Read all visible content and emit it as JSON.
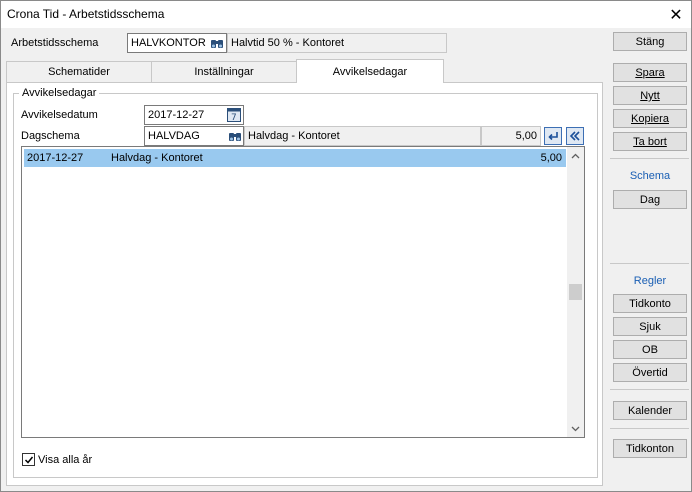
{
  "window": {
    "title": "Crona Tid - Arbetstidsschema",
    "close_glyph": "✕"
  },
  "header": {
    "schema_label": "Arbetstidsschema",
    "schema_code": "HALVKONTOR",
    "schema_desc": "Halvtid 50 % - Kontoret",
    "stang_label": "Stäng"
  },
  "tabs": [
    {
      "label": "Schematider",
      "active": false
    },
    {
      "label": "Inställningar",
      "active": false
    },
    {
      "label": "Avvikelsedagar",
      "active": true
    }
  ],
  "panel": {
    "group_title": "Avvikelsedagar",
    "date_label": "Avvikelsedatum",
    "date_value": "2017-12-27",
    "dagschema_label": "Dagschema",
    "dagschema_code": "HALVDAG",
    "dagschema_desc": "Halvdag - Kontoret",
    "dagschema_hours": "5,00",
    "rows": [
      {
        "date": "2017-12-27",
        "desc": "Halvdag - Kontoret",
        "hours": "5,00",
        "selected": true
      }
    ],
    "visa_alla_label": "Visa alla år",
    "visa_alla_checked": true
  },
  "sidebar": {
    "spara": "Spara",
    "nytt": "Nytt",
    "kopiera": "Kopiera",
    "ta_bort": "Ta bort",
    "schema_heading": "Schema",
    "dag": "Dag",
    "regler_heading": "Regler",
    "tidkonto": "Tidkonto",
    "sjuk": "Sjuk",
    "ob": "OB",
    "overtid": "Övertid",
    "kalender": "Kalender",
    "tidkonton": "Tidkonton"
  },
  "colors": {
    "selection": "#99c9ef",
    "accent": "#1a5fb4"
  },
  "icons": [
    "binoculars-icon",
    "calendar-icon",
    "insert-arrow-icon",
    "collapse-left-icon",
    "scroll-up-icon",
    "scroll-down-icon",
    "checkmark-icon"
  ]
}
